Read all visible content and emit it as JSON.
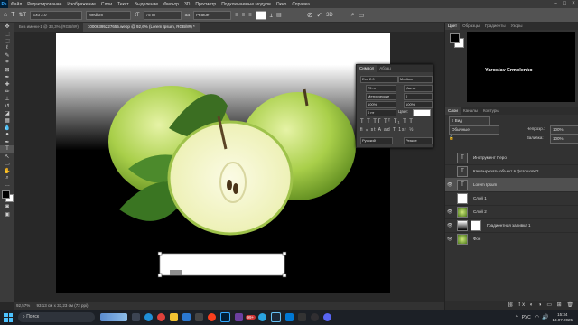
{
  "menu": {
    "logo": "Ps",
    "items": [
      "Файл",
      "Редактирование",
      "Изображение",
      "Слои",
      "Текст",
      "Выделение",
      "Фильтр",
      "3D",
      "Просмотр",
      "Подключаемые модули",
      "Окно",
      "Справка"
    ]
  },
  "options": {
    "font_family": "Exo 2.0",
    "font_style": "Medium",
    "font_size": "75 пт",
    "aa": "Резкое"
  },
  "tabs": [
    {
      "label": "Без имени-1 @ 33,3% (RGB/8#)",
      "active": false
    },
    {
      "label": "10006395227655.webp @ 92,6% (Lorem Ipsum, RGB/8#) *",
      "active": true
    }
  ],
  "status": {
    "zoom": "92,57%",
    "size": "93,13 см x 33,23 см (72 ppi)"
  },
  "character_panel": {
    "tab_char": "Символ",
    "tab_para": "Абзац",
    "font": "Exo 2.0",
    "style": "Medium",
    "size": "75 пт",
    "leading": "(Авто)",
    "kerning": "Метрические",
    "tracking": "0",
    "vscale": "100%",
    "hscale": "100%",
    "baseline": "0 пт",
    "color_label": "Цвет:",
    "lang": "Русский",
    "aa": "Резкое"
  },
  "right_panel": {
    "color_tabs": [
      "Цвет",
      "Образцы",
      "Градиенты",
      "Узоры"
    ],
    "preview_name": "Yaroslav Ermolenko",
    "layers_tabs": [
      "Слои",
      "Каналы",
      "Контуры"
    ],
    "blend_mode": "Обычные",
    "opacity_label": "Непрозр.:",
    "opacity": "100%",
    "fill_label": "Заливка:",
    "fill": "100%",
    "layers": [
      {
        "name": "Инструмент Перо",
        "type": "text",
        "visible": false,
        "selected": false
      },
      {
        "name": "Как вырезать объект в фотошопе?",
        "type": "text",
        "visible": false,
        "selected": false
      },
      {
        "name": "Lorem Ipsum",
        "type": "text",
        "visible": true,
        "selected": true
      },
      {
        "name": "Слой 1",
        "type": "white",
        "visible": false,
        "selected": false
      },
      {
        "name": "Слой 2",
        "type": "apple",
        "visible": true,
        "selected": false
      },
      {
        "name": "Градиентная заливка 1",
        "type": "gradient",
        "visible": true,
        "selected": false
      },
      {
        "name": "Фон",
        "type": "apple",
        "visible": true,
        "selected": false
      }
    ]
  },
  "taskbar": {
    "search": "Поиск",
    "lang": "РУС",
    "time": "15:34",
    "date": "13.07.2025",
    "badge": "99+"
  }
}
